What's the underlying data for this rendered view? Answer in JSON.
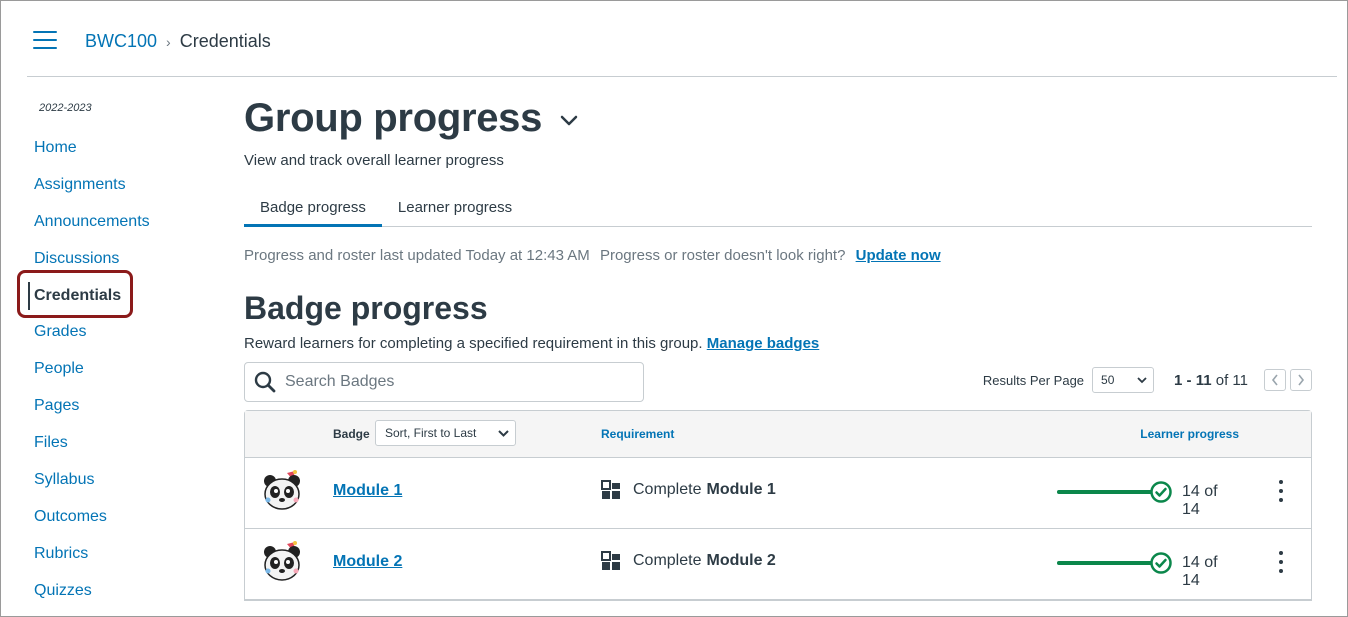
{
  "header": {
    "breadcrumb": {
      "course": "BWC100",
      "current": "Credentials"
    }
  },
  "sidebar": {
    "term": "2022-2023",
    "items": [
      {
        "label": "Home"
      },
      {
        "label": "Assignments"
      },
      {
        "label": "Announcements"
      },
      {
        "label": "Discussions"
      },
      {
        "label": "Credentials",
        "active": true
      },
      {
        "label": "Grades"
      },
      {
        "label": "People"
      },
      {
        "label": "Pages"
      },
      {
        "label": "Files"
      },
      {
        "label": "Syllabus"
      },
      {
        "label": "Outcomes"
      },
      {
        "label": "Rubrics"
      },
      {
        "label": "Quizzes"
      }
    ]
  },
  "main": {
    "title": "Group progress",
    "subtitle": "View and track overall learner progress",
    "tabs": [
      {
        "label": "Badge progress",
        "active": true
      },
      {
        "label": "Learner progress"
      }
    ],
    "status": {
      "updated": "Progress and roster last updated Today at 12:43 AM",
      "question": "Progress or roster doesn't look right?",
      "update_link": "Update now"
    },
    "section": {
      "title": "Badge progress",
      "description": "Reward learners for completing a specified requirement in this group.",
      "manage_link": "Manage badges"
    },
    "search": {
      "placeholder": "Search Badges"
    },
    "pagination": {
      "results_per_page_label": "Results Per Page",
      "results_per_page": "50",
      "range": "1 - 11",
      "of": "of 11"
    },
    "table": {
      "columns": {
        "badge": "Badge",
        "sort": "Sort, First to Last",
        "requirement": "Requirement",
        "progress": "Learner progress"
      },
      "rows": [
        {
          "badge": "Module 1",
          "req_prefix": "Complete",
          "req_target": "Module 1",
          "progress_text": "14 of 14",
          "progress": 1.0
        },
        {
          "badge": "Module 2",
          "req_prefix": "Complete",
          "req_target": "Module 2",
          "progress_text": "14 of 14",
          "progress": 1.0
        }
      ]
    }
  },
  "colors": {
    "link": "#0374b5",
    "text": "#2d3b45",
    "success": "#0b874b",
    "highlight": "#8b1a1a"
  }
}
